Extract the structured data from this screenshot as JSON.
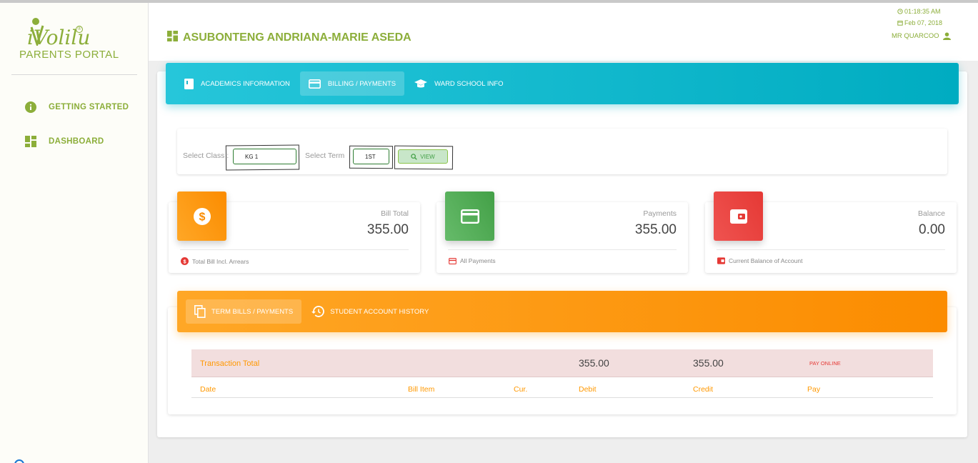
{
  "brand": {
    "logo_text": "iVolilu",
    "logo_reg": "®",
    "subtitle": "PARENTS PORTAL",
    "accent": "#8cae3a"
  },
  "sidebar": {
    "items": [
      {
        "label": "GETTING STARTED",
        "icon": "info-icon"
      },
      {
        "label": "DASHBOARD",
        "icon": "dashboard-icon"
      }
    ]
  },
  "header": {
    "student_name": "ASUBONTENG ANDRIANA-MARIE ASEDA",
    "time": "01:18:35 AM",
    "date": "Feb 07, 2018",
    "user": "MR QUARCOO"
  },
  "tabs": [
    {
      "label": "ACADEMICS INFORMATION",
      "icon": "book-icon"
    },
    {
      "label": "BILLING / PAYMENTS",
      "icon": "credit-card-icon",
      "active": true
    },
    {
      "label": "WARD SCHOOL INFO",
      "icon": "graduation-cap-icon"
    }
  ],
  "filter": {
    "class_label": "Select Class :",
    "class_value": "KG 1",
    "term_label": "Select Term",
    "term_value": "1ST",
    "view_label": "VIEW"
  },
  "stats": [
    {
      "category": "Bill Total",
      "value": "355.00",
      "footer": "Total Bill Incl. Arrears",
      "icon": "dollar-icon",
      "color": "#ff9800"
    },
    {
      "category": "Payments",
      "value": "355.00",
      "footer": "All Payments",
      "icon": "card-icon",
      "color": "#4caf50"
    },
    {
      "category": "Balance",
      "value": "0.00",
      "footer": "Current Balance of Account",
      "icon": "wallet-icon",
      "color": "#e53935"
    }
  ],
  "bottom_tabs": [
    {
      "label": "TERM BILLS / PAYMENTS",
      "icon": "copy-icon",
      "active": true
    },
    {
      "label": "STUDENT ACCOUNT HISTORY",
      "icon": "history-icon"
    }
  ],
  "table": {
    "total_label": "Transaction Total",
    "total_debit": "355.00",
    "total_credit": "355.00",
    "pay_online": "PAY ONLINE",
    "headers": [
      "Date",
      "Bill Item",
      "Cur.",
      "Debit",
      "Credit",
      "Pay"
    ]
  }
}
